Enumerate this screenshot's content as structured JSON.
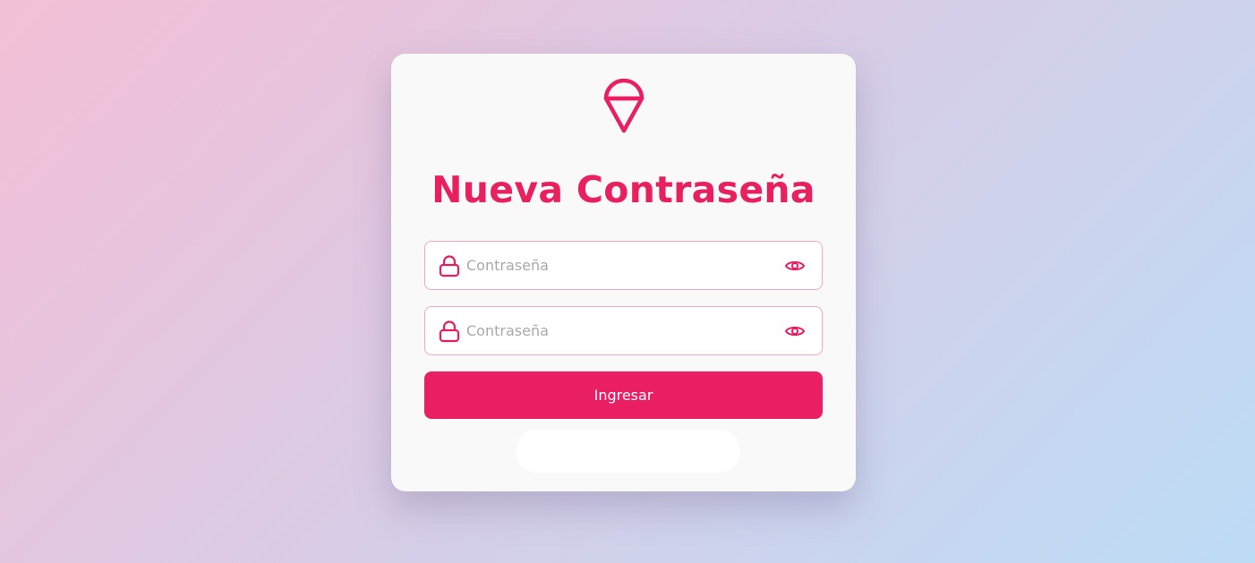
{
  "header": {
    "logo_icon": "ice-cream-cone-icon",
    "title": "Nueva Contraseña"
  },
  "form": {
    "password": {
      "placeholder": "Contraseña",
      "value": "",
      "lead_icon": "lock-icon",
      "toggle_icon": "eye-icon"
    },
    "confirm_password": {
      "placeholder": "Contraseña",
      "value": "",
      "lead_icon": "lock-icon",
      "toggle_icon": "eye-icon"
    },
    "submit_label": "Ingresar"
  },
  "colors": {
    "accent": "#e91e63",
    "title": "#e8205f",
    "field_border": "#f4a7c2",
    "card_bg": "#f9f9f9"
  }
}
